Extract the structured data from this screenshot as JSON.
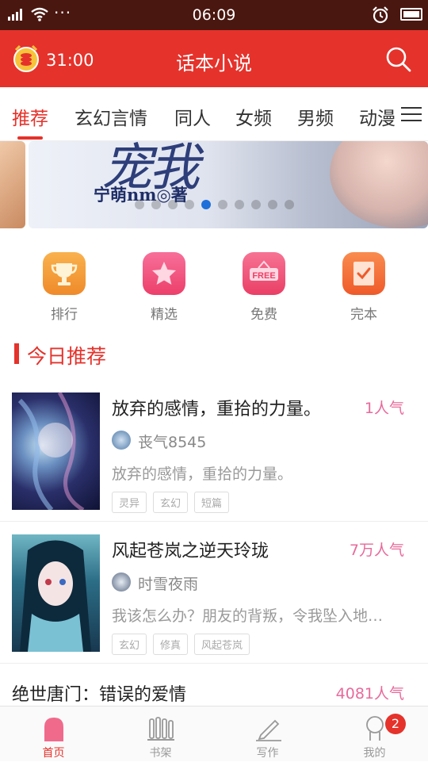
{
  "status_bar": {
    "time": "06:09",
    "dots": "···"
  },
  "header": {
    "timer": "31:00",
    "title": "话本小说"
  },
  "tabs": [
    {
      "label": "推荐",
      "active": true
    },
    {
      "label": "玄幻言情"
    },
    {
      "label": "同人"
    },
    {
      "label": "女频"
    },
    {
      "label": "男频"
    },
    {
      "label": "动漫"
    }
  ],
  "banner": {
    "title_text": "宠我",
    "author_text": "宁萌nm◎著",
    "dot_count": 10,
    "active_dot": 4
  },
  "quick_links": [
    {
      "label": "排行",
      "icon": "trophy-icon",
      "color": "#f5a03a"
    },
    {
      "label": "精选",
      "icon": "star-icon",
      "color": "#f0507a"
    },
    {
      "label": "免费",
      "icon": "free-tag-icon",
      "icon_text": "FREE",
      "color": "#ef5578"
    },
    {
      "label": "完本",
      "icon": "check-book-icon",
      "color": "#f5723a"
    }
  ],
  "section": {
    "title": "今日推荐"
  },
  "books": [
    {
      "title": "放弃的感情，重拾的力量。",
      "popularity": "1人气",
      "author": "丧气8545",
      "desc": "放弃的感情，重拾的力量。",
      "tags": [
        "灵异",
        "玄幻",
        "短篇"
      ]
    },
    {
      "title": "风起苍岚之逆天玲珑",
      "popularity": "7万人气",
      "author": "时雪夜雨",
      "desc": "我该怎么办？朋友的背叛，令我坠入地…",
      "tags": [
        "玄幻",
        "修真",
        "风起苍岚"
      ]
    },
    {
      "title": "绝世唐门：错误的爱情",
      "popularity": "4081人气"
    }
  ],
  "bottom_nav": [
    {
      "label": "首页",
      "icon": "home-icon",
      "active": true
    },
    {
      "label": "书架",
      "icon": "bookshelf-icon"
    },
    {
      "label": "写作",
      "icon": "pen-icon"
    },
    {
      "label": "我的",
      "icon": "profile-icon"
    }
  ],
  "badge": {
    "count": "2"
  },
  "colors": {
    "brand": "#e5322b",
    "popularity": "#e86a9a",
    "status_bar": "#4a1710"
  }
}
